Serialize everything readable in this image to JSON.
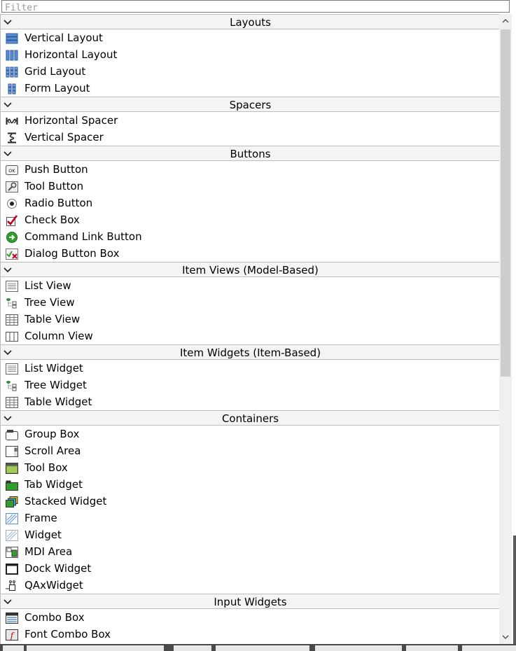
{
  "filter": {
    "placeholder": "Filter",
    "value": ""
  },
  "categories": [
    {
      "title": "Layouts",
      "items": [
        {
          "label": "Vertical Layout",
          "icon": "vertical-layout-icon"
        },
        {
          "label": "Horizontal Layout",
          "icon": "horizontal-layout-icon"
        },
        {
          "label": "Grid Layout",
          "icon": "grid-layout-icon"
        },
        {
          "label": "Form Layout",
          "icon": "form-layout-icon"
        }
      ]
    },
    {
      "title": "Spacers",
      "items": [
        {
          "label": "Horizontal Spacer",
          "icon": "horizontal-spacer-icon"
        },
        {
          "label": "Vertical Spacer",
          "icon": "vertical-spacer-icon"
        }
      ]
    },
    {
      "title": "Buttons",
      "items": [
        {
          "label": "Push Button",
          "icon": "push-button-icon"
        },
        {
          "label": "Tool Button",
          "icon": "tool-button-icon"
        },
        {
          "label": "Radio Button",
          "icon": "radio-button-icon"
        },
        {
          "label": "Check Box",
          "icon": "check-box-icon"
        },
        {
          "label": "Command Link Button",
          "icon": "command-link-icon"
        },
        {
          "label": "Dialog Button Box",
          "icon": "dialog-button-box-icon"
        }
      ]
    },
    {
      "title": "Item Views (Model-Based)",
      "items": [
        {
          "label": "List View",
          "icon": "list-icon"
        },
        {
          "label": "Tree View",
          "icon": "tree-icon"
        },
        {
          "label": "Table View",
          "icon": "table-icon"
        },
        {
          "label": "Column View",
          "icon": "column-view-icon"
        }
      ]
    },
    {
      "title": "Item Widgets (Item-Based)",
      "items": [
        {
          "label": "List Widget",
          "icon": "list-icon"
        },
        {
          "label": "Tree Widget",
          "icon": "tree-icon"
        },
        {
          "label": "Table Widget",
          "icon": "table-icon"
        }
      ]
    },
    {
      "title": "Containers",
      "items": [
        {
          "label": "Group Box",
          "icon": "group-box-icon"
        },
        {
          "label": "Scroll Area",
          "icon": "scroll-area-icon"
        },
        {
          "label": "Tool Box",
          "icon": "tool-box-icon"
        },
        {
          "label": "Tab Widget",
          "icon": "tab-widget-icon"
        },
        {
          "label": "Stacked Widget",
          "icon": "stacked-widget-icon"
        },
        {
          "label": "Frame",
          "icon": "frame-icon"
        },
        {
          "label": "Widget",
          "icon": "widget-icon"
        },
        {
          "label": "MDI Area",
          "icon": "mdi-area-icon"
        },
        {
          "label": "Dock Widget",
          "icon": "dock-widget-icon"
        },
        {
          "label": "QAxWidget",
          "icon": "qaxwidget-icon"
        }
      ]
    },
    {
      "title": "Input Widgets",
      "items": [
        {
          "label": "Combo Box",
          "icon": "combo-box-icon"
        },
        {
          "label": "Font Combo Box",
          "icon": "font-combo-box-icon"
        }
      ]
    }
  ],
  "colors": {
    "header_bg": "#f4f4f4",
    "border": "#bdbdbd",
    "scrollbar_thumb": "#cdcdcd",
    "check_red": "#c0001a",
    "green": "#2f9e2f"
  }
}
